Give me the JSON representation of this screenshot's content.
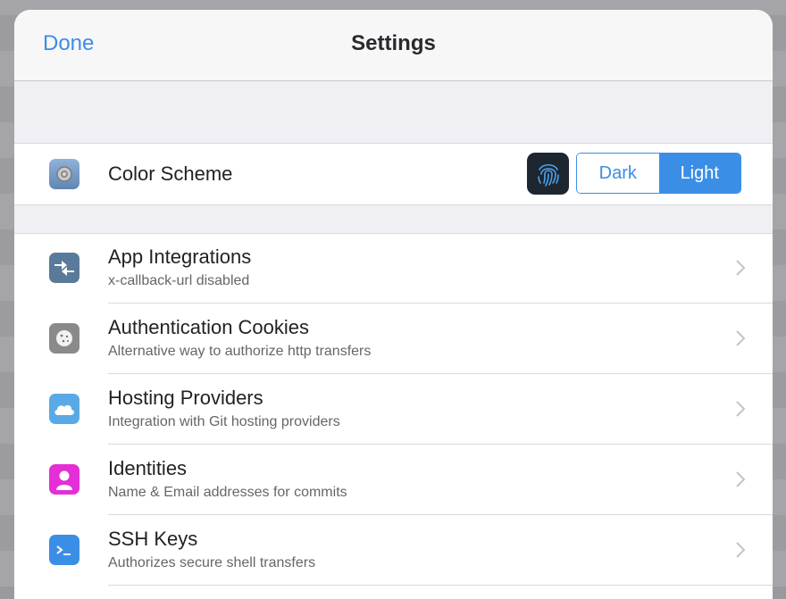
{
  "navbar": {
    "done_label": "Done",
    "title": "Settings"
  },
  "color_scheme": {
    "label": "Color Scheme",
    "icon": "gear-icon",
    "fingerprint_icon": "fingerprint-icon",
    "options": [
      "Dark",
      "Light"
    ],
    "selected": "Light"
  },
  "rows": [
    {
      "label": "App Integrations",
      "sublabel": "x-callback-url disabled",
      "icon": "arrows-icon",
      "icon_color": "#5a7a99"
    },
    {
      "label": "Authentication Cookies",
      "sublabel": "Alternative way to authorize http transfers",
      "icon": "cookie-icon",
      "icon_color": "#8a8a8a"
    },
    {
      "label": "Hosting Providers",
      "sublabel": "Integration with Git hosting providers",
      "icon": "cloud-icon",
      "icon_color": "#5aa9e6"
    },
    {
      "label": "Identities",
      "sublabel": "Name & Email addresses for commits",
      "icon": "person-icon",
      "icon_color": "#e52fd6"
    },
    {
      "label": "SSH Keys",
      "sublabel": "Authorizes secure shell transfers",
      "icon": "terminal-icon",
      "icon_color": "#3b8ee6"
    }
  ],
  "colors": {
    "accent": "#3b8ee6",
    "background": "#efeff4"
  }
}
